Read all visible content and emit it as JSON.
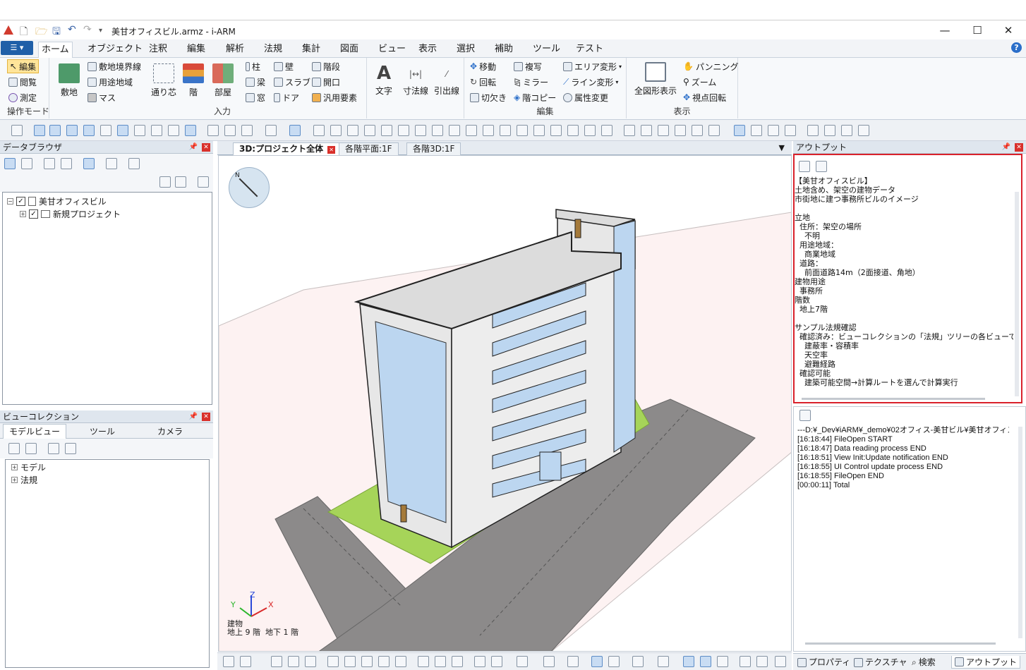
{
  "window": {
    "title": "美甘オフィスビル.armz - i-ARM",
    "controls": {
      "minimize": "—",
      "maximize": "☐",
      "close": "✕"
    }
  },
  "ribbon_tabs": [
    "ホーム",
    "オブジェクト",
    "注釈",
    "編集",
    "解析",
    "法規",
    "集計",
    "図面",
    "ビュー",
    "表示",
    "選択",
    "補助",
    "ツール",
    "テスト"
  ],
  "ribbon": {
    "mode": {
      "edit": "編集",
      "browse": "閲覧",
      "measure": "測定",
      "label": "操作モード"
    },
    "input": {
      "site": "敷地",
      "site_boundary": "敷地境界線",
      "use_zone": "用途地域",
      "mass": "マス",
      "grid": "通り芯",
      "floor": "階",
      "room": "部屋",
      "column": "柱",
      "beam": "梁",
      "window": "窓",
      "wall": "壁",
      "slab": "スラブ",
      "door": "ドア",
      "stairs": "階段",
      "opening": "開口",
      "generic": "汎用要素",
      "label": "入力"
    },
    "text": {
      "text": "文字",
      "dimension": "寸法線",
      "leader": "引出線"
    },
    "edit": {
      "move": "移動",
      "rotate": "回転",
      "cut": "切欠き",
      "copy": "複写",
      "mirror": "ミラー",
      "floor_copy": "階コピー",
      "area_transform": "エリア変形",
      "line_transform": "ライン変形",
      "attr_change": "属性変更",
      "label": "編集"
    },
    "display": {
      "fit_all": "全図形表示",
      "pan": "パンニング",
      "zoom": "ズーム",
      "orbit": "視点回転",
      "label": "表示"
    }
  },
  "data_browser": {
    "title": "データブラウザ",
    "tree": [
      {
        "label": "美甘オフィスビル",
        "expander": "−",
        "checked": "✓"
      },
      {
        "label": "新規プロジェクト",
        "expander": "+",
        "checked": "✓"
      }
    ]
  },
  "view_collection": {
    "title": "ビューコレクション",
    "tabs": [
      "モデルビュー",
      "ツール",
      "カメラ"
    ],
    "tree": [
      {
        "label": "モデル",
        "expander": "+"
      },
      {
        "label": "法規",
        "expander": "+"
      }
    ]
  },
  "view_tabs": [
    {
      "label": "3D:プロジェクト全体",
      "active": true
    },
    {
      "label": "各階平面:1F",
      "active": false
    },
    {
      "label": "各階3D:1F",
      "active": false
    }
  ],
  "viewport": {
    "compass_label": "N",
    "axis_labels": {
      "x": "X",
      "y": "Y",
      "z": "Z"
    },
    "info_line1": "建物",
    "info_line2": "地上 9 階  地下 1 階",
    "colors": {
      "background": "#ffffff",
      "ground": "#fdf2f2",
      "lawn": "#a6d459",
      "road": "#8c8a8a",
      "wall": "#e7e7e7",
      "glass": "#bcd6f0",
      "roof": "#dcdcdc"
    }
  },
  "output": {
    "title": "アウトプット",
    "text": "【美甘オフィスビル】\n土地含め、架空の建物データ\n市街地に建つ事務所ビルのイメージ\n\n立地\n  住所：架空の場所\n    不明\n  用途地域：\n    商業地域\n  道路：\n    前面道路14m（2面接道、角地）\n建物用途\n  事務所\n階数\n  地上7階\n\nサンプル法規確認\n  確認済み：ビューコレクションの「法規」ツリーの各ビューで確認:\n    建蔽率・容積率\n    天空率\n    避難経路\n  確認可能\n    建築可能空間→計算ルートを選んで計算実行",
    "log": "---D:¥_Dev¥iARM¥_demo¥02オフィス-美甘ビル¥美甘オフィスビル\n[16:18:44] FileOpen START\n[16:18:47] Data reading process END\n[16:18:51] View Init:Update notification END\n[16:18:55] UI Control update process END\n[16:18:55] FileOpen END\n[00:00:11] Total",
    "highlight_color": "#d9212b"
  },
  "bottom_tabs": [
    "プロパティ",
    "テクスチャ",
    "検索",
    "アウトプット"
  ]
}
